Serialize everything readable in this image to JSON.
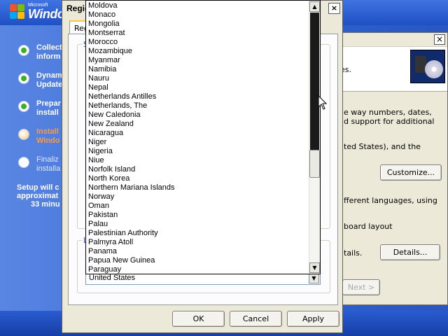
{
  "setup": {
    "logo_small": "Microsoft",
    "logo_big": "Windo",
    "steps": [
      {
        "label_1": "Collect",
        "label_2": "inform",
        "state": "done"
      },
      {
        "label_1": "Dynam",
        "label_2": "Update",
        "state": "done"
      },
      {
        "label_1": "Prepar",
        "label_2": "install",
        "state": "done"
      },
      {
        "label_1": "Install",
        "label_2": "Windo",
        "state": "current"
      },
      {
        "label_1": "Finaliz",
        "label_2": "installa",
        "state": "pending"
      }
    ],
    "remaining_1": "Setup will c",
    "remaining_2": "approximat",
    "remaining_3": "33 minu"
  },
  "wizard": {
    "header_text": "ges.",
    "line_1": "e way numbers, dates,",
    "line_2": "d support for additional",
    "line_3": "ted States), and the",
    "customize_label": "Customize...",
    "line_4": "fferent languages, using",
    "line_5": "board layout",
    "line_6": "tails.",
    "details_label": "Details...",
    "next_label": "Next >",
    "close_glyph": "×"
  },
  "regional": {
    "title": "Regio",
    "tab_label": "Regio",
    "group1_label": "S",
    "group2_label": "L",
    "help_glyph": "?",
    "close_glyph": "×",
    "ok_label": "OK",
    "cancel_label": "Cancel",
    "apply_label": "Apply"
  },
  "dropdown": {
    "items": [
      "Moldova",
      "Monaco",
      "Mongolia",
      "Montserrat",
      "Morocco",
      "Mozambique",
      "Myanmar",
      "Namibia",
      "Nauru",
      "Nepal",
      "Netherlands Antilles",
      "Netherlands, The",
      "New Caledonia",
      "New Zealand",
      "Nicaragua",
      "Niger",
      "Nigeria",
      "Niue",
      "Norfolk Island",
      "North Korea",
      "Northern Mariana Islands",
      "Norway",
      "Oman",
      "Pakistan",
      "Palau",
      "Palestinian Authority",
      "Palmyra Atoll",
      "Panama",
      "Papua New Guinea",
      "Paraguay"
    ],
    "selected_value": "United States",
    "up_glyph": "▲",
    "down_glyph": "▼"
  }
}
